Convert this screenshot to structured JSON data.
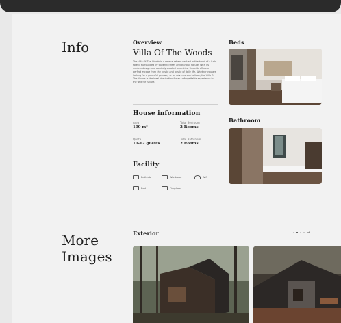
{
  "info": {
    "heading": "Info",
    "overview_label": "Overview",
    "title": "Villa Of The Woods",
    "description": "The Villa Of The Woods is a serene retreat nestled in the heart of a lush forest, surrounded by towering trees and tranquil nature. With its modern design and carefully curated amenities, this villa offers a perfect escape from the hustle and bustle of daily life. Whether you are looking for a peaceful getaway or an adventurous holiday, the Villa Of The Woods is the ideal destination for an unforgettable experience in the wild for nature."
  },
  "house_information": {
    "label": "House information",
    "items": [
      {
        "key": "Area",
        "value": "100 m²"
      },
      {
        "key": "Total Bedroom",
        "value": "2 Rooms"
      },
      {
        "key": "Quota",
        "value": "10-12 guests"
      },
      {
        "key": "Total Bathroom",
        "value": "2 Rooms"
      }
    ]
  },
  "facility": {
    "label": "Facility",
    "items": [
      {
        "label": "Bathtub",
        "icon": "bathtub-icon"
      },
      {
        "label": "Wardrobe",
        "icon": "wardrobe-icon"
      },
      {
        "label": "Wifi",
        "icon": "wifi-icon"
      },
      {
        "label": "Bed",
        "icon": "bed-icon"
      },
      {
        "label": "Fireplace",
        "icon": "fireplace-icon"
      }
    ]
  },
  "beds": {
    "label": "Beds"
  },
  "bathroom": {
    "label": "Bathroom"
  },
  "more_images": {
    "heading": "More Images",
    "exterior_label": "Exterior"
  },
  "slider": {
    "dots": 4,
    "active": 1,
    "arrow": "→"
  },
  "colors": {
    "background": "#f2f2f2",
    "text": "#1e1e1e",
    "divider": "#cfcfcf"
  }
}
